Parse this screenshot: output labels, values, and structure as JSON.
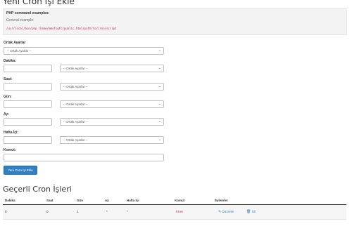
{
  "page_title": "Yeni Cron İşi Ekle",
  "info": {
    "heading": "PHP command examples:",
    "general": "General example:",
    "example_cmd": "/usr/local/bin/php /home/mmofsgfc/public_html/path/to/cron/script"
  },
  "form": {
    "common_label": "Ortak Ayarlar",
    "common_select": "-- Ortak Ayarlar --",
    "minute_label": "Dakika:",
    "hour_label": "Saat:",
    "day_label": "Gün:",
    "month_label": "Ay:",
    "weekday_label": "Hafta İçi:",
    "command_label": "Komut:",
    "field_select": "-- Ortak Ayarlar --",
    "submit_label": "Yeni Cron İşi Ekle"
  },
  "current": {
    "title": "Geçerli Cron İşleri",
    "columns": [
      "Dakika",
      "Saat",
      "Gün",
      "Ay",
      "Hafta İçi",
      "Komut",
      "Eylemler"
    ],
    "row": {
      "minute": "0",
      "hour": "0",
      "day": "1",
      "month": "*",
      "weekday": "*",
      "command": "kiem",
      "edit": "Düzenle",
      "delete": "Sil"
    }
  },
  "icons": {
    "chevron": "chevron-down-icon",
    "edit": "pencil-icon",
    "delete": "trash-icon"
  },
  "colors": {
    "primary": "#2f7fc2",
    "code": "#c7254e"
  }
}
